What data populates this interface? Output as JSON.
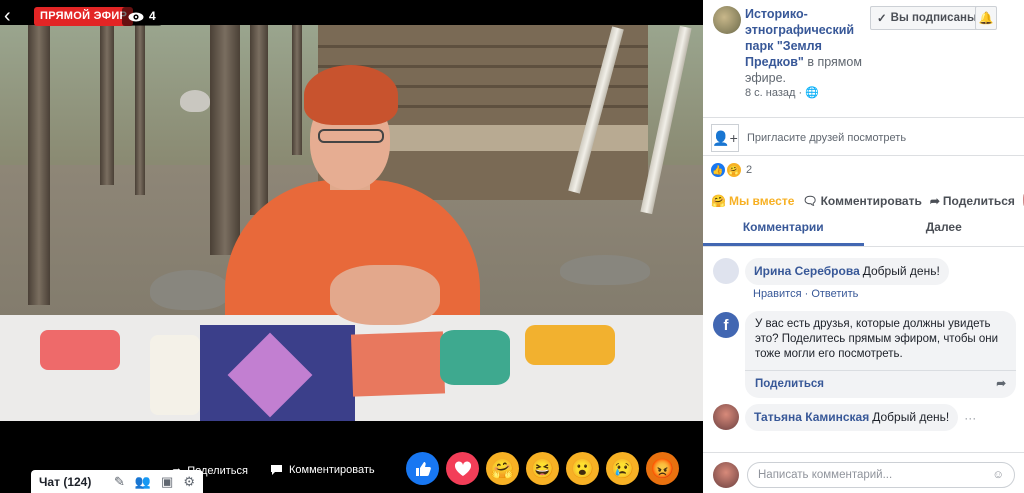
{
  "video": {
    "live_label": "ПРЯМОЙ ЭФИР",
    "viewer_count": "4",
    "bottom_actions": {
      "share": "Поделиться",
      "comment": "Комментировать"
    },
    "chat": {
      "label": "Чат (124)"
    },
    "reactions": [
      "like",
      "love",
      "haha-care",
      "laugh",
      "wow",
      "sad",
      "angry"
    ]
  },
  "panel": {
    "page_name": "Историко-этнографический парк \"Земля Предков\"",
    "status_suffix": "в прямом эфире.",
    "time": "8 с. назад",
    "subscribe_label": "Вы подписаны",
    "invite_label": "Пригласите друзей посмотреть",
    "reaction_count": "2",
    "actions": {
      "together": "Мы вместе",
      "comment": "Комментировать",
      "share": "Поделиться"
    },
    "tabs": {
      "comments": "Комментарии",
      "next": "Далее"
    },
    "comments": [
      {
        "author": "Ирина Сереброва",
        "text": "Добрый день!",
        "like": "Нравится",
        "reply": "Ответить"
      },
      {
        "author": "Татьяна Каминская",
        "text": "Добрый день!"
      }
    ],
    "share_card": {
      "text": "У вас есть друзья, которые должны увидеть это? Поделитесь прямым эфиром, чтобы они тоже могли его посмотреть.",
      "link": "Поделиться"
    },
    "composer_placeholder": "Написать комментарий..."
  },
  "colors": {
    "live_red": "#e32525",
    "fb_blue": "#4267b2",
    "link_blue": "#385898"
  }
}
